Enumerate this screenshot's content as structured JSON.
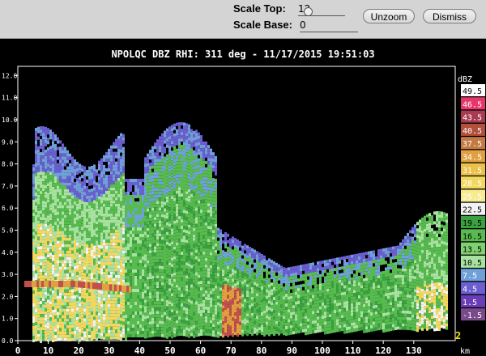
{
  "controls": {
    "scale_top_label": "Scale Top:",
    "scale_top_value": "12",
    "scale_base_label": "Scale Base:",
    "scale_base_value": "0",
    "unzoom_label": "Unzoom",
    "dismiss_label": "Dismiss"
  },
  "plot": {
    "title": "NPOLQC DBZ  RHI: 311 deg  -  11/17/2015 19:51:03",
    "x_ticks": [
      "0",
      "10",
      "20",
      "30",
      "40",
      "50",
      "60",
      "70",
      "80",
      "90",
      "100",
      "110",
      "120",
      "130"
    ],
    "x_unit": "km",
    "y_ticks": [
      "0.0",
      "1.0",
      "2.0",
      "3.0",
      "4.0",
      "5.0",
      "6.0",
      "7.0",
      "8.0",
      "9.0",
      "10.0",
      "11.0",
      "12.0"
    ],
    "corner_label": "2",
    "colorbar_unit": "dBZ",
    "colorbar": [
      {
        "label": "49.5",
        "color": "#ffffff"
      },
      {
        "label": "46.5",
        "color": "#e8356a"
      },
      {
        "label": "43.5",
        "color": "#a83a52"
      },
      {
        "label": "40.5",
        "color": "#b2503b"
      },
      {
        "label": "37.5",
        "color": "#c47a43"
      },
      {
        "label": "34.5",
        "color": "#e1a040"
      },
      {
        "label": "31.5",
        "color": "#eac14a"
      },
      {
        "label": "28.5",
        "color": "#f3d860"
      },
      {
        "label": "25.5",
        "color": "#f7eb8f"
      },
      {
        "label": "22.5",
        "color": "#f2f2f2"
      },
      {
        "label": "19.5",
        "color": "#3aa040"
      },
      {
        "label": "16.5",
        "color": "#57bb4f"
      },
      {
        "label": "13.5",
        "color": "#7fd06e"
      },
      {
        "label": "10.5",
        "color": "#a9e2a0"
      },
      {
        "label": "7.5",
        "color": "#6fa0d8"
      },
      {
        "label": "4.5",
        "color": "#6b5ed0"
      },
      {
        "label": "1.5",
        "color": "#6a3cb6"
      },
      {
        "label": "-1.5",
        "color": "#7a4a8a"
      }
    ]
  }
}
